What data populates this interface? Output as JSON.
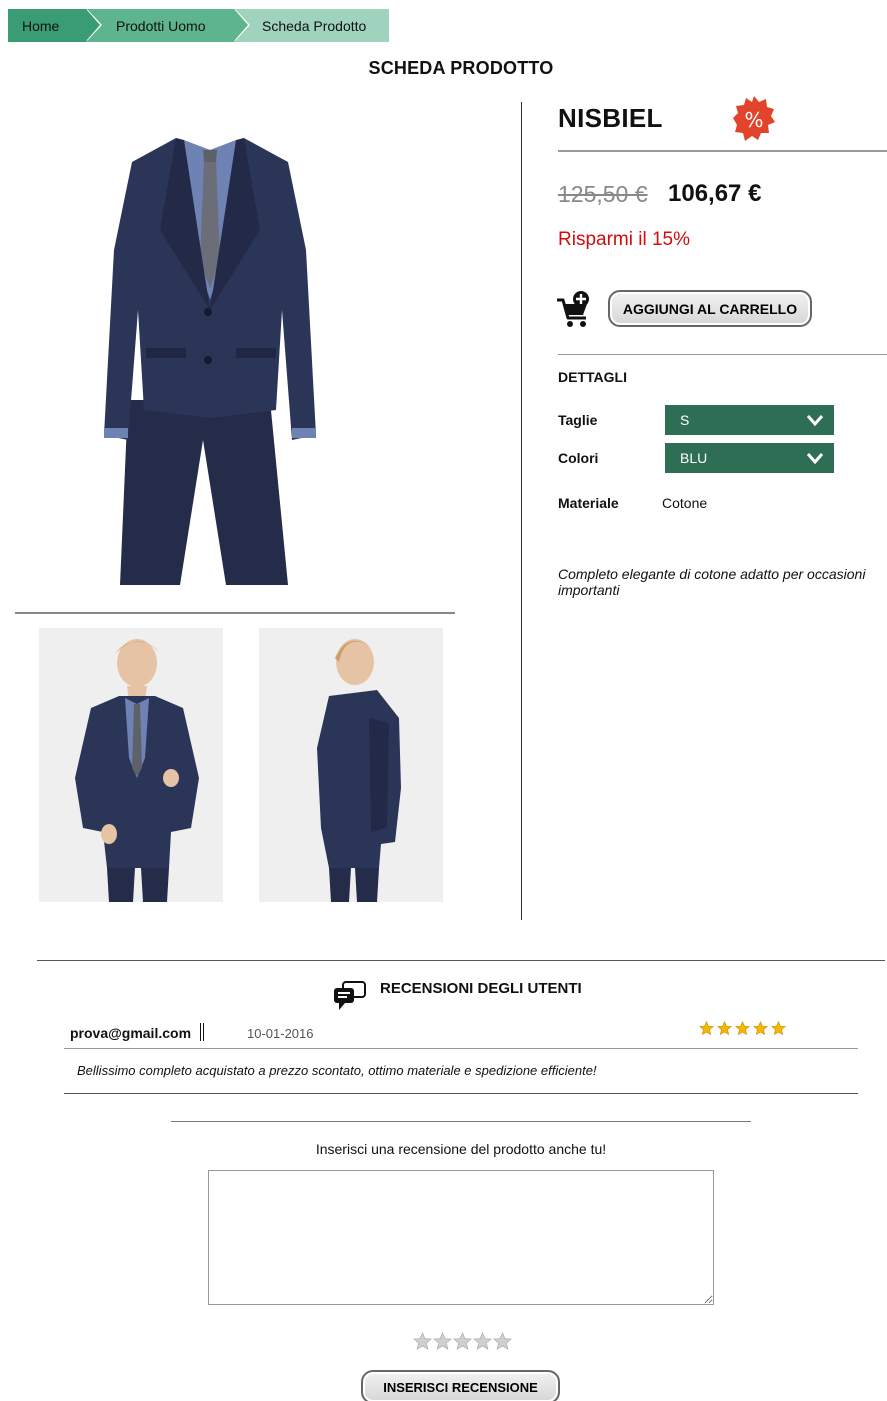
{
  "breadcrumb": {
    "home": "Home",
    "category": "Prodotti Uomo",
    "current": "Scheda Prodotto"
  },
  "page": {
    "title": "SCHEDA PRODOTTO"
  },
  "product": {
    "name": "NISBIEL",
    "badge_symbol": "%",
    "old_price": "125,50 €",
    "new_price": "106,67 €",
    "savings": "Risparmi il 15%",
    "add_to_cart": "AGGIUNGI AL CARRELLO",
    "details_heading": "DETTAGLI",
    "sizes_label": "Taglie",
    "size_selected": "S",
    "colors_label": "Colori",
    "color_selected": "BLU",
    "material_label": "Materiale",
    "material_value": "Cotone",
    "description": "Completo elegante di cotone adatto per occasioni importanti"
  },
  "reviews": {
    "title": "RECENSIONI DEGLI UTENTI",
    "items": [
      {
        "user": "prova@gmail.com",
        "date": "10-01-2016",
        "rating": 5,
        "text": "Bellissimo completo acquistato a prezzo scontato, ottimo materiale e spedizione efficiente!"
      }
    ],
    "form_prompt": "Inserisci una recensione del prodotto anche tu!",
    "textarea_value": "",
    "rating_selected": 0,
    "submit_label": "INSERISCI RECENSIONE"
  },
  "colors": {
    "crumb_home": "#3a9c74",
    "crumb_mid": "#5db48d",
    "crumb_current": "#9fd3bd",
    "select_bg": "#2e6e55",
    "savings": "#d00c0c",
    "badge": "#e2432b",
    "star_filled": "#f5b800",
    "star_empty": "#cfcfcf"
  },
  "icons": {
    "cart": "cart-add-icon",
    "reviews": "speech-bubbles-icon",
    "dropdown": "chevron-down-icon",
    "star": "star-icon"
  }
}
